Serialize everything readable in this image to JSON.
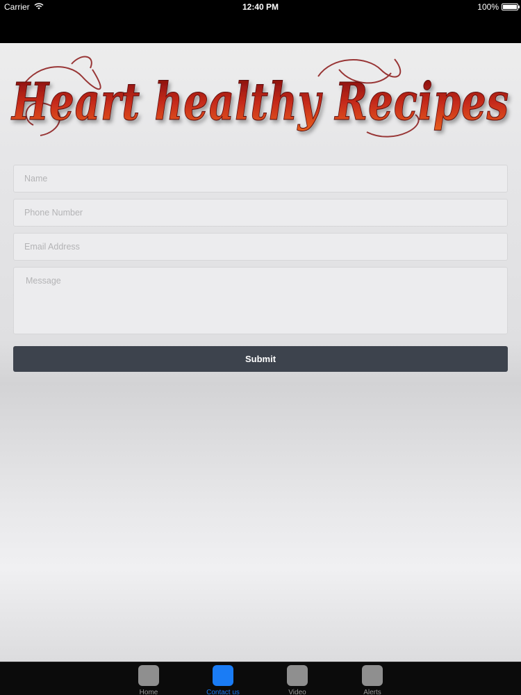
{
  "status_bar": {
    "carrier": "Carrier",
    "time": "12:40 PM",
    "battery_percent": "100%",
    "battery_level": 1.0
  },
  "header": {
    "logo_text": "Heart healthy Recipes",
    "logo_color": "#b01e1e"
  },
  "form": {
    "name_placeholder": "Name",
    "phone_placeholder": "Phone Number",
    "email_placeholder": "Email Address",
    "message_placeholder": "Message",
    "submit_label": "Submit",
    "submit_color": "#3d434d"
  },
  "tab_bar": {
    "active_color": "#1a7cf5",
    "tabs": [
      {
        "label": "Home",
        "icon": "home-icon",
        "active": false
      },
      {
        "label": "Contact us",
        "icon": "contact-icon",
        "active": true
      },
      {
        "label": "Video",
        "icon": "video-icon",
        "active": false
      },
      {
        "label": "Alerts",
        "icon": "alerts-icon",
        "active": false
      }
    ]
  }
}
